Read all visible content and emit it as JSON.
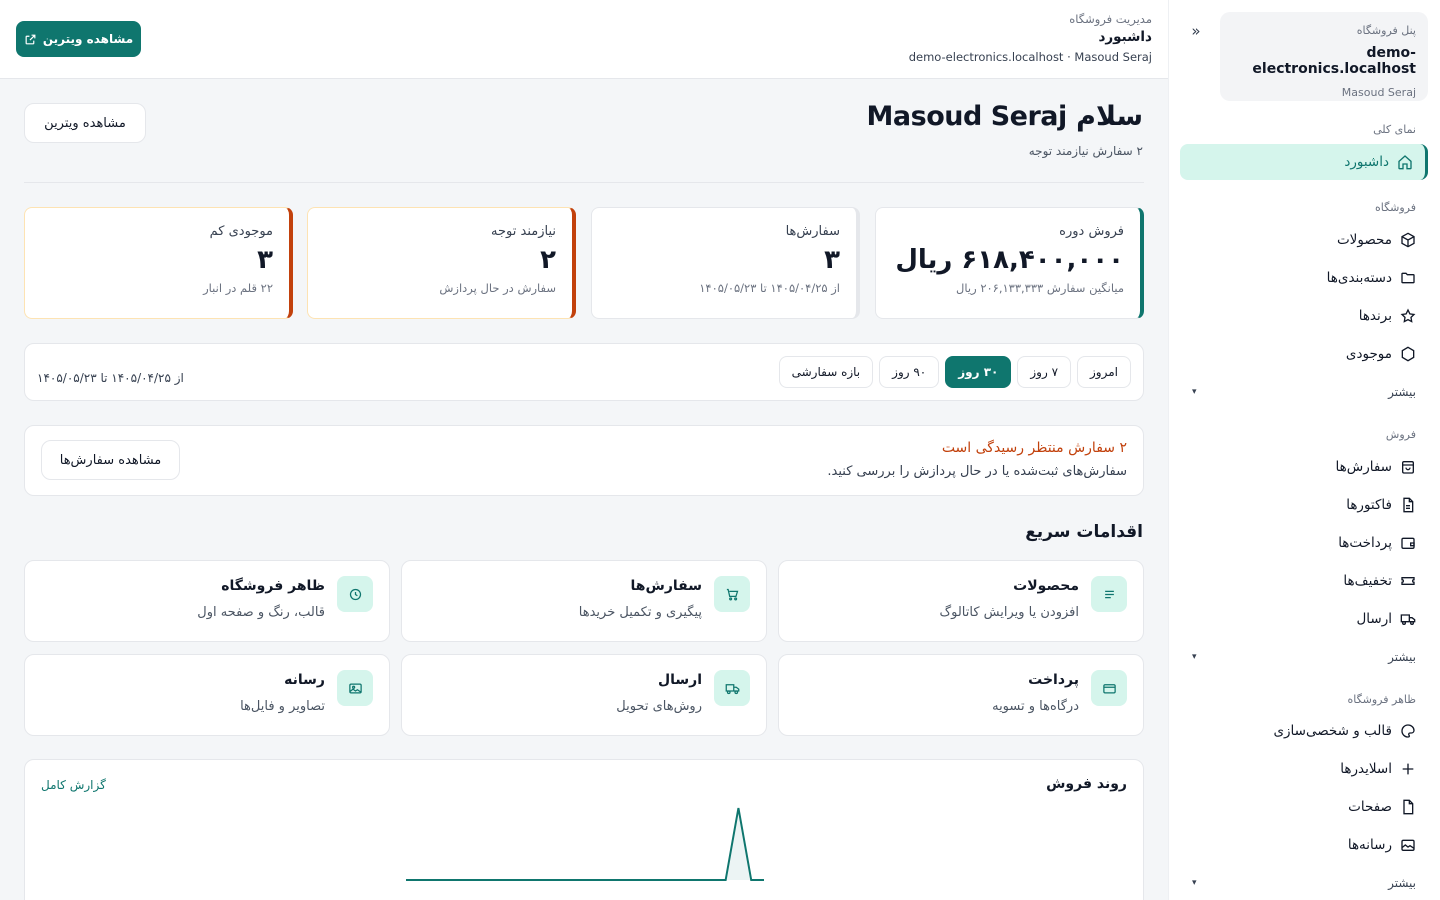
{
  "sidebar": {
    "store_kicker": "پنل فروشگاه",
    "store_domain": "demo-electronics.localhost",
    "store_user": "Masoud Seraj",
    "collapse": "«",
    "sections": {
      "overview": "نمای کلی",
      "store": "فروشگاه",
      "sales": "فروش",
      "appearance": "ظاهر فروشگاه"
    },
    "items": {
      "dashboard": "داشبورد",
      "products": "محصولات",
      "categories": "دسته‌بندی‌ها",
      "brands": "برندها",
      "inventory": "موجودی",
      "orders": "سفارش‌ها",
      "invoices": "فاکتورها",
      "payments": "پرداخت‌ها",
      "discounts": "تخفیف‌ها",
      "shipping": "ارسال",
      "theme": "قالب و شخصی‌سازی",
      "sliders": "اسلایدرها",
      "pages": "صفحات",
      "media": "رسانه‌ها"
    },
    "more_label": "بیشتر",
    "more_caret": "▾"
  },
  "header": {
    "breadcrumb": "مدیریت فروشگاه",
    "title": "داشبورد",
    "subtitle": "demo-electronics.localhost · Masoud Seraj",
    "storefront_button": "مشاهده ویترین"
  },
  "main": {
    "greeting": "سلام Masoud Seraj",
    "attention_note": "۲ سفارش نیازمند توجه",
    "storefront_button": "مشاهده ویترین",
    "stats": {
      "sales": {
        "label": "فروش دوره",
        "value": "۶۱۸,۴۰۰,۰۰۰ ریال",
        "hint": "میانگین سفارش ۲۰۶,۱۳۳,۳۳۳ ریال"
      },
      "orders": {
        "label": "سفارش‌ها",
        "value": "۳",
        "hint": "از ۱۴۰۵/۰۴/۲۵ تا ۱۴۰۵/۰۵/۲۳"
      },
      "attention": {
        "label": "نیازمند توجه",
        "value": "۲",
        "hint": "سفارش در حال پردازش"
      },
      "low_stock": {
        "label": "موجودی کم",
        "value": "۳",
        "hint": "۲۲ قلم در انبار"
      }
    },
    "filters": {
      "chips": [
        "امروز",
        "۷ روز",
        "۳۰ روز",
        "۹۰ روز",
        "بازه سفارشی"
      ],
      "active_index": 2,
      "range_label": "از ۱۴۰۵/۰۴/۲۵ تا ۱۴۰۵/۰۵/۲۳"
    },
    "alert": {
      "title": "۲ سفارش منتظر رسیدگی است",
      "description": "سفارش‌های ثبت‌شده یا در حال پردازش را بررسی کنید.",
      "button": "مشاهده سفارش‌ها"
    },
    "quick_actions_title": "اقدامات سریع",
    "quick_actions": {
      "products": {
        "title": "محصولات",
        "desc": "افزودن یا ویرایش کاتالوگ"
      },
      "orders": {
        "title": "سفارش‌ها",
        "desc": "پیگیری و تکمیل خریدها"
      },
      "appearance": {
        "title": "ظاهر فروشگاه",
        "desc": "قالب، رنگ و صفحه اول"
      },
      "payment": {
        "title": "پرداخت",
        "desc": "درگاه‌ها و تسویه"
      },
      "shipping": {
        "title": "ارسال",
        "desc": "روش‌های تحویل"
      },
      "media": {
        "title": "رسانه",
        "desc": "تصاویر و فایل‌ها"
      }
    },
    "sales_trend": {
      "title": "روند فروش",
      "full_report": "گزارش کامل"
    }
  },
  "colors": {
    "brand": "#0f766e",
    "brand_soft": "#d5f5ec",
    "warning": "#c2410c"
  },
  "chart_data": {
    "type": "area",
    "title": "روند فروش",
    "series": [
      {
        "values": [
          0,
          0,
          0,
          0,
          0,
          0,
          0,
          0,
          0,
          0,
          0,
          0,
          0,
          0,
          0,
          0,
          0,
          0,
          0,
          0,
          0,
          0,
          0,
          0,
          0,
          0,
          1,
          0,
          0
        ]
      }
    ],
    "grid": false,
    "legend": "none"
  }
}
